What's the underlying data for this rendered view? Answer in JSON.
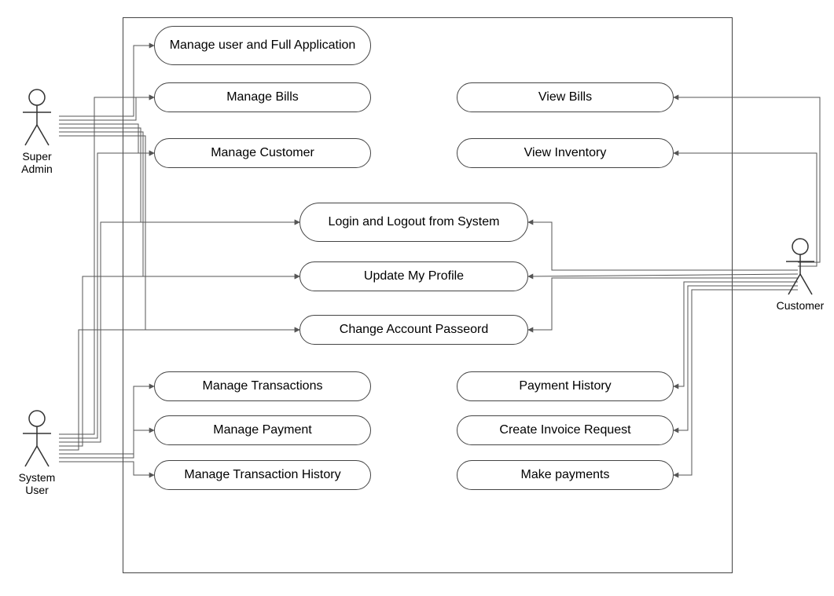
{
  "actors": {
    "super_admin": "Super Admin",
    "system_user": "System User",
    "customer": "Customer"
  },
  "usecases": {
    "manage_user_full_app": "Manage user and Full Application",
    "manage_bills": "Manage Bills",
    "manage_customer": "Manage Customer",
    "view_bills": "View Bills",
    "view_inventory": "View Inventory",
    "login_logout": "Login and Logout from System",
    "update_profile": "Update My Profile",
    "change_password": "Change Account Passeord",
    "manage_transactions": "Manage Transactions",
    "manage_payment": "Manage Payment",
    "manage_txn_history": "Manage Transaction History",
    "payment_history": "Payment History",
    "create_invoice_request": "Create Invoice Request",
    "make_payments": "Make payments"
  },
  "chart_data": {
    "type": "diagram",
    "diagram_type": "uml-use-case",
    "title": "",
    "actors": [
      "Super Admin",
      "System User",
      "Customer"
    ],
    "use_cases": [
      "Manage user and Full Application",
      "Manage Bills",
      "Manage Customer",
      "View Bills",
      "View Inventory",
      "Login and Logout from System",
      "Update My Profile",
      "Change Account Passeord",
      "Manage Transactions",
      "Manage Payment",
      "Manage Transaction History",
      "Payment History",
      "Create Invoice Request",
      "Make payments"
    ],
    "associations": [
      {
        "actor": "Super Admin",
        "use_case": "Manage user and Full Application"
      },
      {
        "actor": "Super Admin",
        "use_case": "Manage Bills"
      },
      {
        "actor": "Super Admin",
        "use_case": "Manage Customer"
      },
      {
        "actor": "Super Admin",
        "use_case": "Login and Logout from System"
      },
      {
        "actor": "Super Admin",
        "use_case": "Update My Profile"
      },
      {
        "actor": "Super Admin",
        "use_case": "Change Account Passeord"
      },
      {
        "actor": "System User",
        "use_case": "Manage Bills"
      },
      {
        "actor": "System User",
        "use_case": "Manage Customer"
      },
      {
        "actor": "System User",
        "use_case": "Login and Logout from System"
      },
      {
        "actor": "System User",
        "use_case": "Update My Profile"
      },
      {
        "actor": "System User",
        "use_case": "Change Account Passeord"
      },
      {
        "actor": "System User",
        "use_case": "Manage Transactions"
      },
      {
        "actor": "System User",
        "use_case": "Manage Payment"
      },
      {
        "actor": "System User",
        "use_case": "Manage Transaction History"
      },
      {
        "actor": "Customer",
        "use_case": "View Bills"
      },
      {
        "actor": "Customer",
        "use_case": "View Inventory"
      },
      {
        "actor": "Customer",
        "use_case": "Login and Logout from System"
      },
      {
        "actor": "Customer",
        "use_case": "Update My Profile"
      },
      {
        "actor": "Customer",
        "use_case": "Change Account Passeord"
      },
      {
        "actor": "Customer",
        "use_case": "Payment History"
      },
      {
        "actor": "Customer",
        "use_case": "Create Invoice Request"
      },
      {
        "actor": "Customer",
        "use_case": "Make payments"
      }
    ]
  }
}
